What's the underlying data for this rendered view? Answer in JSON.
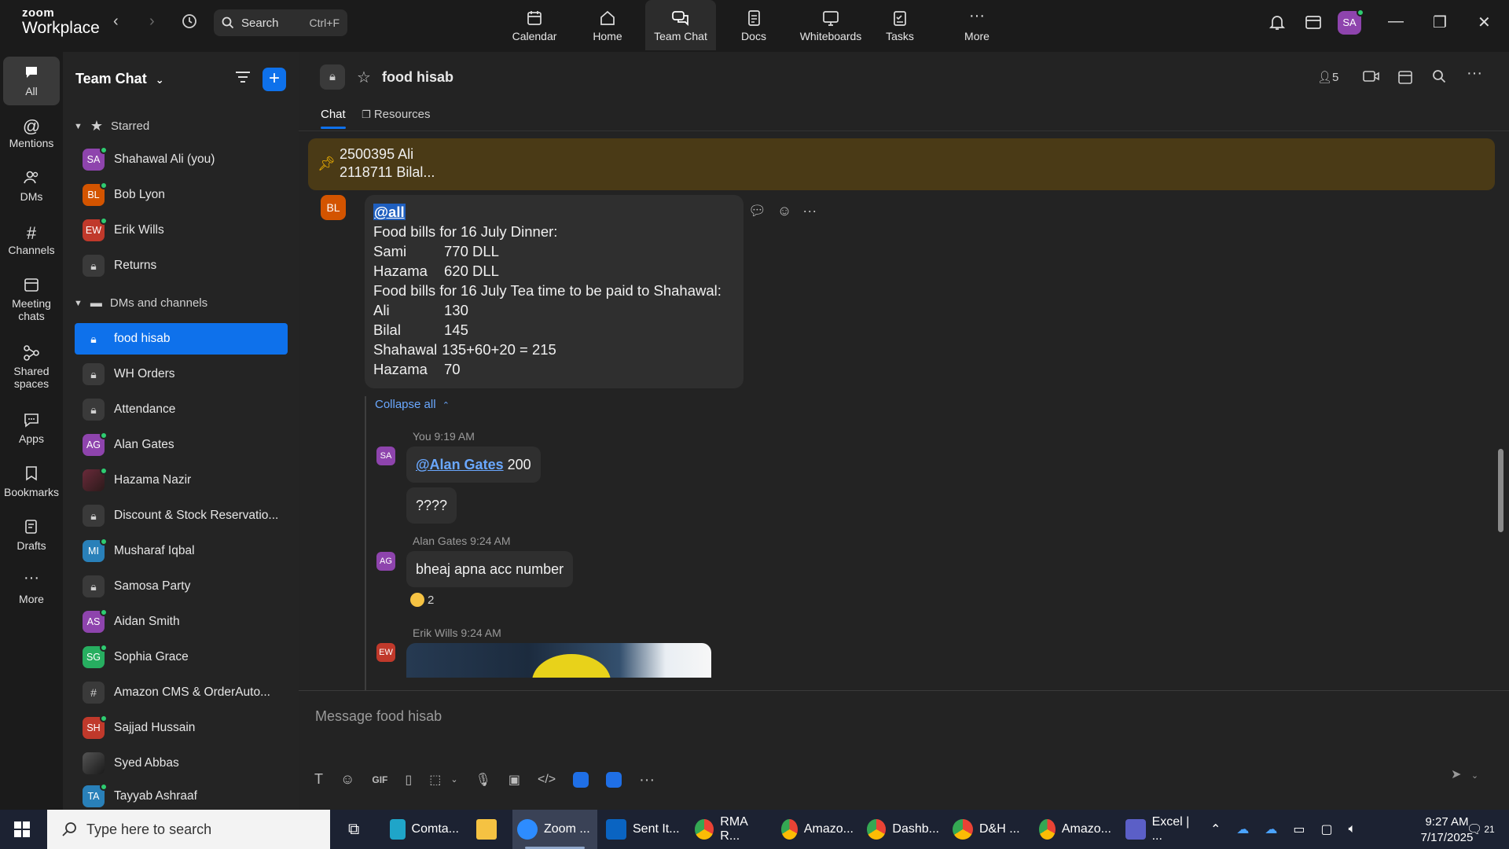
{
  "app": {
    "logo_line1": "zoom",
    "logo_line2": "Workplace",
    "search_label": "Search",
    "search_shortcut": "Ctrl+F",
    "user_initials": "SA"
  },
  "topnav": [
    {
      "label": "Calendar"
    },
    {
      "label": "Home"
    },
    {
      "label": "Team Chat"
    },
    {
      "label": "Docs"
    },
    {
      "label": "Whiteboards"
    },
    {
      "label": "Tasks"
    },
    {
      "label": "More"
    }
  ],
  "rail": [
    {
      "label": "All"
    },
    {
      "label": "Mentions"
    },
    {
      "label": "DMs"
    },
    {
      "label": "Channels"
    },
    {
      "label": "Meeting chats"
    },
    {
      "label": "Shared spaces"
    },
    {
      "label": "Apps"
    },
    {
      "label": "Bookmarks"
    },
    {
      "label": "Drafts"
    },
    {
      "label": "More"
    }
  ],
  "sidebar": {
    "title": "Team Chat",
    "starred_label": "Starred",
    "dms_label": "DMs and channels",
    "starred": [
      {
        "name": "Shahawal Ali (you)",
        "initials": "SA",
        "color": "#8e44ad"
      },
      {
        "name": "Bob Lyon",
        "initials": "BL",
        "color": "#d35400"
      },
      {
        "name": "Erik Wills",
        "initials": "EW",
        "color": "#c0392b"
      },
      {
        "name": "Returns"
      }
    ],
    "items": [
      {
        "name": "food hisab"
      },
      {
        "name": "WH Orders"
      },
      {
        "name": "Attendance"
      },
      {
        "name": "Alan Gates",
        "initials": "AG",
        "color": "#8e44ad"
      },
      {
        "name": "Hazama Nazir"
      },
      {
        "name": "Discount & Stock Reservatio..."
      },
      {
        "name": "Musharaf Iqbal",
        "initials": "MI",
        "color": "#2980b9"
      },
      {
        "name": "Samosa Party"
      },
      {
        "name": "Aidan Smith",
        "initials": "AS",
        "color": "#8e44ad"
      },
      {
        "name": "Sophia Grace",
        "initials": "SG",
        "color": "#27ae60"
      },
      {
        "name": "Amazon CMS & OrderAuto..."
      },
      {
        "name": "Sajjad Hussain",
        "initials": "SH",
        "color": "#c0392b"
      },
      {
        "name": "Syed Abbas"
      },
      {
        "name": "Tayyab Ashraaf",
        "initials": "TA",
        "color": "#2980b9"
      }
    ]
  },
  "channel": {
    "name": "food hisab",
    "tab_chat": "Chat",
    "tab_resources": "Resources",
    "member_count": "5"
  },
  "pinned": {
    "line1": "2500395    Ali",
    "line2": "2118711    Bilal..."
  },
  "message": {
    "author_initials": "BL",
    "mention": "@all",
    "title1": "Food bills for 16 July Dinner:",
    "rows1": [
      {
        "name": "Sami",
        "value": "770   DLL"
      },
      {
        "name": "Hazama",
        "value": "620   DLL"
      }
    ],
    "title2": "Food bills for 16 July Tea time to be paid to Shahawal:",
    "rows2": [
      {
        "name": "Ali",
        "value": "130"
      },
      {
        "name": "Bilal",
        "value": "145"
      },
      {
        "name": "Shahawal",
        "value": "135+60+20 = 215"
      },
      {
        "name": "Hazama",
        "value": "70"
      }
    ]
  },
  "thread": {
    "collapse_label": "Collapse all",
    "reply1_meta": "You 9:19 AM",
    "reply1_initials": "SA",
    "reply1_mention": "@Alan Gates",
    "reply1_text": " 200",
    "reply2_text": "????",
    "reply3_meta": "Alan Gates 9:24 AM",
    "reply3_initials": "AG",
    "reply3_text": "bheaj apna acc number",
    "reaction_count": "2",
    "reply4_meta": "Erik Wills 9:24 AM",
    "reply4_initials": "EW"
  },
  "composer": {
    "placeholder": "Message food hisab",
    "gif_label": "GIF"
  },
  "taskbar": {
    "search_placeholder": "Type here to search",
    "apps": [
      {
        "label": "Comta..."
      },
      {
        "label": ""
      },
      {
        "label": "Zoom ..."
      },
      {
        "label": "Sent It..."
      },
      {
        "label": "RMA R..."
      },
      {
        "label": "Amazo..."
      },
      {
        "label": "Dashb..."
      },
      {
        "label": "D&H ..."
      },
      {
        "label": "Amazo..."
      },
      {
        "label": "Excel | ..."
      }
    ],
    "time": "9:27 AM",
    "date": "7/17/2025",
    "notifications": "21"
  }
}
